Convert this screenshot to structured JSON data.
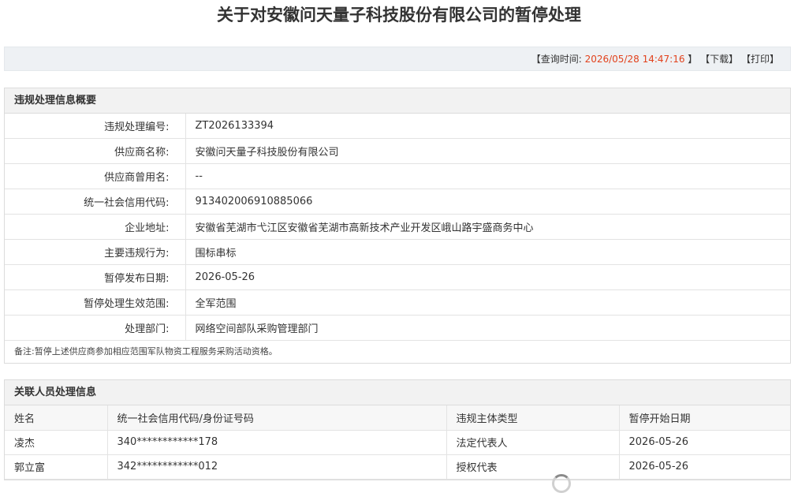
{
  "page_title": "关于对安徽问天量子科技股份有限公司的暂停处理",
  "toolbar": {
    "query_label": "【查询时间:",
    "query_time": "2026/05/28 14:47:16",
    "query_end": "】",
    "download": "【下载】",
    "print": "【打印】"
  },
  "overview": {
    "heading": "违规处理信息概要",
    "rows": [
      {
        "label": "违规处理编号:",
        "value": "ZT2026133394"
      },
      {
        "label": "供应商名称:",
        "value": "安徽问天量子科技股份有限公司"
      },
      {
        "label": "供应商曾用名:",
        "value": "--"
      },
      {
        "label": "统一社会信用代码:",
        "value": "913402006910885066"
      },
      {
        "label": "企业地址:",
        "value": "安徽省芜湖市弋江区安徽省芜湖市高新技术产业开发区峨山路宇盛商务中心"
      },
      {
        "label": "主要违规行为:",
        "value": "围标串标"
      },
      {
        "label": "暂停发布日期:",
        "value": "2026-05-26"
      },
      {
        "label": "暂停处理生效范围:",
        "value": "全军范围"
      },
      {
        "label": "处理部门:",
        "value": "网络空间部队采购管理部门"
      }
    ],
    "note": "备注:暂停上述供应商参加相应范围军队物资工程服务采购活动资格。"
  },
  "related": {
    "heading": "关联人员处理信息",
    "columns": [
      "姓名",
      "统一社会信用代码/身份证号码",
      "违规主体类型",
      "暂停开始日期"
    ],
    "rows": [
      [
        "凌杰",
        "340************178",
        "法定代表人",
        "2026-05-26"
      ],
      [
        "郭立富",
        "342************012",
        "授权代表",
        "2026-05-26"
      ]
    ]
  }
}
